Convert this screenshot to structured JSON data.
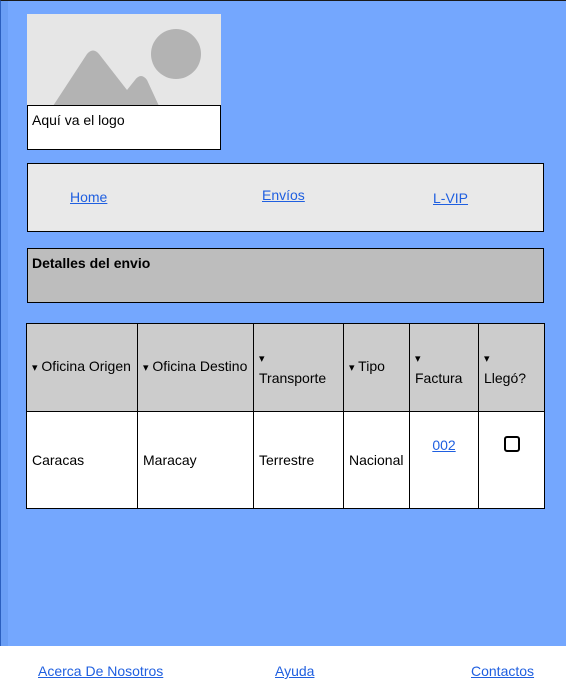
{
  "logo": {
    "caption": "Aquí va el logo"
  },
  "nav": {
    "home": "Home",
    "envios": "Envíos",
    "lvip": "L-VIP"
  },
  "details": {
    "title": "Detalles del envio"
  },
  "table": {
    "headers": [
      "▾ Oficina Origen",
      "▾ Oficina Destino",
      "▾ Transporte",
      "▾ Tipo",
      "▾ Factura",
      "▾ Llegó?"
    ],
    "header_parts": [
      {
        "arrow": "▾",
        "label": "Oficina Origen"
      },
      {
        "arrow": "▾",
        "label": "Oficina Destino"
      },
      {
        "arrow": "▾",
        "label": "Transporte"
      },
      {
        "arrow": "▾",
        "label": "Tipo"
      },
      {
        "arrow": "▾",
        "label": "Factura"
      },
      {
        "arrow": "▾",
        "label": "Llegó?"
      }
    ],
    "rows": [
      {
        "origen": "Caracas",
        "destino": "Maracay",
        "transporte": "Terrestre",
        "tipo": "Nacional",
        "factura": "002",
        "llego": false
      }
    ]
  },
  "footer": {
    "about": "Acerca De Nosotros",
    "help": "Ayuda",
    "contacts": "Contactos"
  },
  "colors": {
    "background": "#74a7fe",
    "link": "#1f5fe0",
    "header_cell": "#cccccc",
    "details_bar": "#bdbdbd"
  }
}
